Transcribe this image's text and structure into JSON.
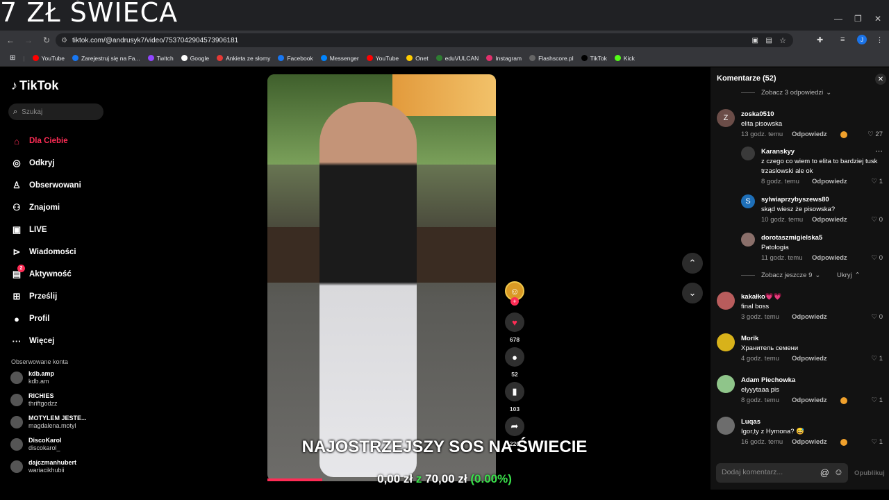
{
  "overlay_title": "7 ZŁ ŚWIECA",
  "browser": {
    "url": "tiktok.com/@andrusyk7/video/7537042904573906181",
    "profile_initial": "J",
    "bookmarks": [
      {
        "label": "YouTube",
        "color": "#ff0000"
      },
      {
        "label": "Zarejestruj się na Fa...",
        "color": "#1877f2"
      },
      {
        "label": "Twitch",
        "color": "#9146ff"
      },
      {
        "label": "Google",
        "color": "#ffffff"
      },
      {
        "label": "Ankieta ze słomy",
        "color": "#e53935"
      },
      {
        "label": "Facebook",
        "color": "#1877f2"
      },
      {
        "label": "Messenger",
        "color": "#0084ff"
      },
      {
        "label": "YouTube",
        "color": "#ff0000"
      },
      {
        "label": "Onet",
        "color": "#ffcc00"
      },
      {
        "label": "eduVULCAN",
        "color": "#2e7d32"
      },
      {
        "label": "Instagram",
        "color": "#e1306c"
      },
      {
        "label": "Flashscore.pl",
        "color": "#666666"
      },
      {
        "label": "TikTok",
        "color": "#000000"
      },
      {
        "label": "Kick",
        "color": "#53fc18"
      }
    ]
  },
  "sidebar": {
    "logo": "TikTok",
    "search_placeholder": "Szukaj",
    "items": [
      {
        "label": "Dla Ciebie",
        "icon": "home-icon",
        "active": true
      },
      {
        "label": "Odkryj",
        "icon": "compass-icon"
      },
      {
        "label": "Obserwowani",
        "icon": "following-icon"
      },
      {
        "label": "Znajomi",
        "icon": "friends-icon"
      },
      {
        "label": "LIVE",
        "icon": "live-icon"
      },
      {
        "label": "Wiadomości",
        "icon": "messages-icon"
      },
      {
        "label": "Aktywność",
        "icon": "activity-icon",
        "badge": "2"
      },
      {
        "label": "Prześlij",
        "icon": "upload-icon"
      },
      {
        "label": "Profil",
        "icon": "profile-icon"
      },
      {
        "label": "Więcej",
        "icon": "more-icon"
      }
    ],
    "followed_heading": "Obserwowane konta",
    "followed": [
      {
        "name": "kdb.amp",
        "handle": "kdb.am"
      },
      {
        "name": "RICHIES",
        "handle": "thriftgodzz"
      },
      {
        "name": "MOTYLEM JESTE...",
        "handle": "magdalena.motyl"
      },
      {
        "name": "DiscoKarol",
        "handle": "discokarol_"
      },
      {
        "name": "dajczmanhubert",
        "handle": "wariacikhubii"
      }
    ]
  },
  "video": {
    "caption_main": "NAJOSTRZEJSZY SOS NA ŚWIECIE",
    "caption_amount": "0,00 zł",
    "caption_z": "z",
    "caption_goal": "70,00 zł",
    "caption_pct": "(0.00%)",
    "progress": 0.24,
    "likes": "678",
    "comments": "52",
    "saves": "103",
    "shares": "220"
  },
  "comments_panel": {
    "title": "Komentarze (52)",
    "see_replies_top": "Zobacz 3 odpowiedzi",
    "see_more": "Zobacz jeszcze 9",
    "hide": "Ukryj",
    "reply_label": "Odpowiedz",
    "input_placeholder": "Dodaj komentarz...",
    "post_label": "Opublikuj",
    "items": [
      {
        "user": "zoska0510",
        "text": "elita pisowska",
        "time": "13 godz. temu",
        "likes": "27",
        "avatar": "Z",
        "avatar_color": "#6b4d48"
      },
      {
        "user": "Karanskyy",
        "text": "z czego co wiem to elita to bardziej tusk",
        "text2": "trzaslowski ale ok",
        "time": "8 godz. temu",
        "likes": "1",
        "avatar": "",
        "avatar_color": "#3a3a3a"
      },
      {
        "user": "sylwiaprzybyszews80",
        "text": "skąd wiesz że pisowska?",
        "time": "10 godz. temu",
        "likes": "0",
        "avatar": "S",
        "avatar_color": "#1e6fb8"
      },
      {
        "user": "dorotaszmigielska5",
        "text": "Patologia",
        "time": "11 godz. temu",
        "likes": "0",
        "avatar": "",
        "avatar_color": "#8a6f6a"
      },
      {
        "user": "kakałko💗💗",
        "text": "final boss",
        "time": "3 godz. temu",
        "likes": "0",
        "avatar": "",
        "avatar_color": "#b85c5c"
      },
      {
        "user": "Morik",
        "text": "Хранитель семени",
        "time": "4 godz. temu",
        "likes": "1",
        "avatar": "",
        "avatar_color": "#d8b21a"
      },
      {
        "user": "Adam Piechowka",
        "text": "elyyytaaa pis",
        "time": "8 godz. temu",
        "likes": "1",
        "avatar": "",
        "avatar_color": "#8fc58a"
      },
      {
        "user": "Luqas",
        "text": "Igor,ty z Hymona? 😅",
        "time": "16 godz. temu",
        "likes": "1",
        "avatar": "",
        "avatar_color": "#6d6d6d"
      }
    ]
  }
}
